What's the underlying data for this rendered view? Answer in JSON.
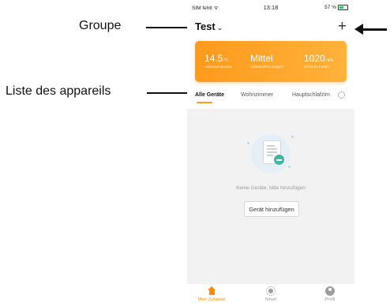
{
  "annotations": {
    "groupe": "Groupe",
    "liste": "Liste des appareils"
  },
  "status_bar": {
    "carrier": "SIM fehlt",
    "time": "13:18",
    "battery": "57 %"
  },
  "header": {
    "title": "Test",
    "add_label": "+"
  },
  "weather": {
    "temperature": {
      "value": "14.5",
      "unit": "°C",
      "label": "Außentemperatur"
    },
    "humidity": {
      "value": "Mittel",
      "label": "Außenluftfeuchtigkeit"
    },
    "pressure": {
      "value": "1020",
      "unit": "hPa",
      "label": "Druck im Freien"
    }
  },
  "tabs": [
    {
      "label": "Alle Geräte",
      "active": true
    },
    {
      "label": "Wohnzimmer",
      "active": false
    },
    {
      "label": "Hauptschlafzim",
      "active": false
    }
  ],
  "empty_state": {
    "message": "Keine Geräte; bitte hinzufügen",
    "button": "Gerät hinzufügen"
  },
  "bottom_nav": [
    {
      "label": "Mein Zuhause",
      "icon": "home-icon",
      "active": true
    },
    {
      "label": "Smart",
      "icon": "smart-icon",
      "active": false
    },
    {
      "label": "Profil",
      "icon": "profile-icon",
      "active": false
    }
  ],
  "colors": {
    "accent": "#ff9a1c",
    "content_bg": "#f2f2f2",
    "empty_icon": "#3fb7a3"
  }
}
